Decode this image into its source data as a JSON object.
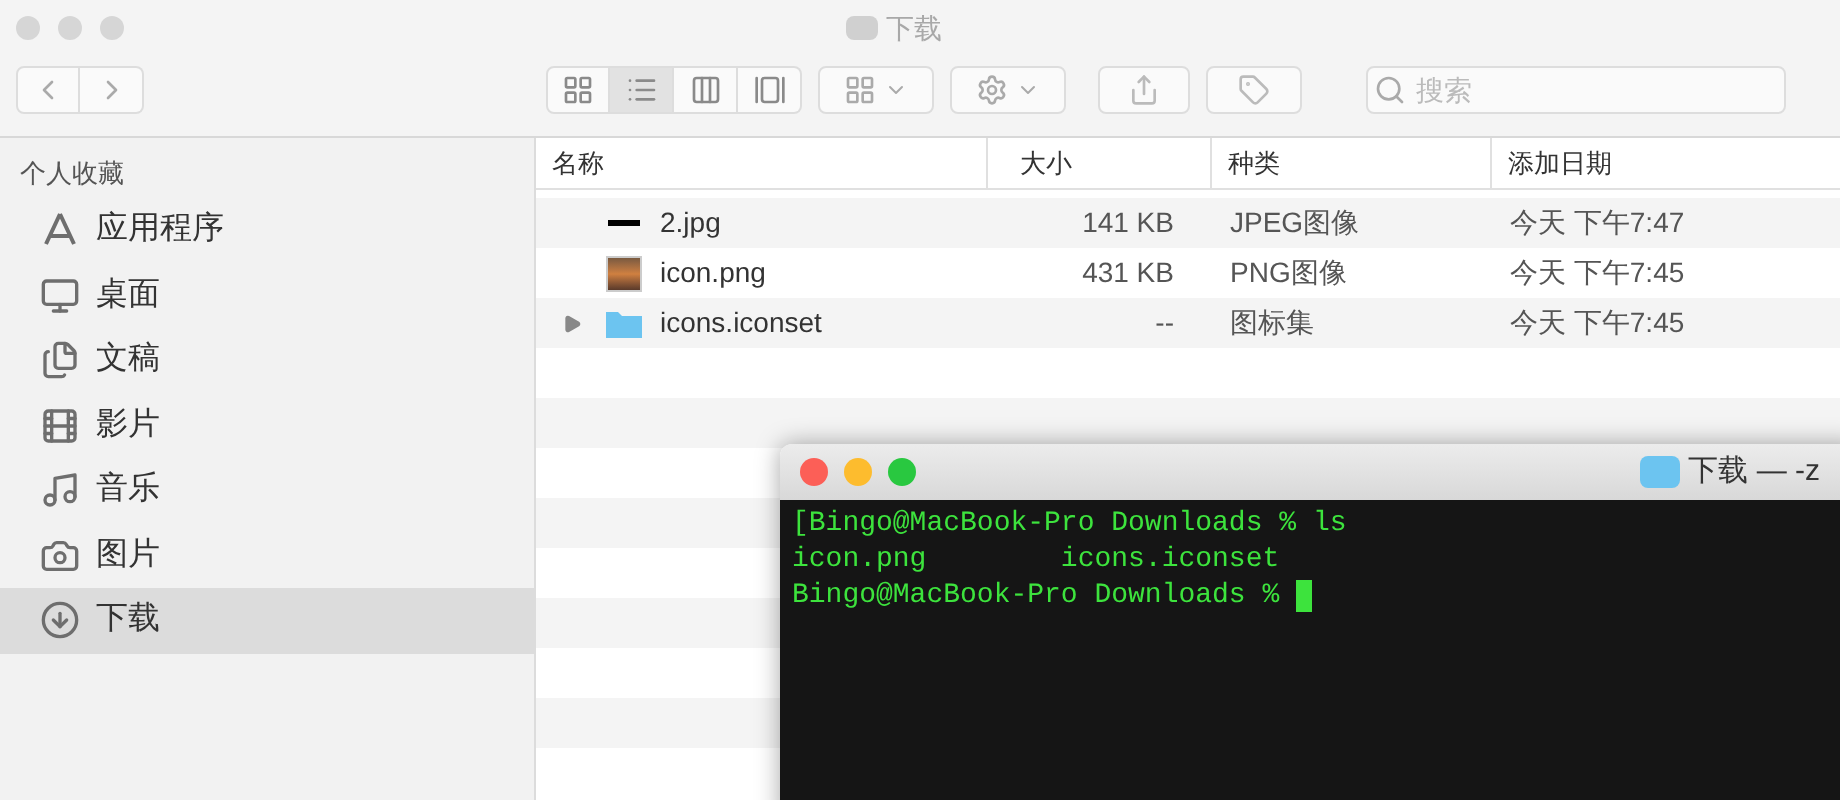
{
  "window": {
    "title": "下载"
  },
  "toolbar": {
    "view_modes": [
      {
        "kind": "icons",
        "selected": false
      },
      {
        "kind": "list",
        "selected": true
      },
      {
        "kind": "columns",
        "selected": false
      },
      {
        "kind": "gallery",
        "selected": false
      }
    ],
    "search": {
      "placeholder": "搜索"
    }
  },
  "sidebar": {
    "section": "个人收藏",
    "items": [
      {
        "label": "应用程序",
        "kind": "apps",
        "selected": false
      },
      {
        "label": "桌面",
        "kind": "desktop",
        "selected": false
      },
      {
        "label": "文稿",
        "kind": "documents",
        "selected": false
      },
      {
        "label": "影片",
        "kind": "movies",
        "selected": false
      },
      {
        "label": "音乐",
        "kind": "music",
        "selected": false
      },
      {
        "label": "图片",
        "kind": "pictures",
        "selected": false
      },
      {
        "label": "下载",
        "kind": "downloads",
        "selected": true
      }
    ]
  },
  "table": {
    "columns": [
      "名称",
      "大小",
      "种类",
      "添加日期"
    ],
    "rows": [
      {
        "kind": "jpg",
        "name": "2.jpg",
        "size": "141 KB",
        "type": "JPEG图像",
        "date": "今天 下午7:47"
      },
      {
        "kind": "png",
        "name": "icon.png",
        "size": "431 KB",
        "type": "PNG图像",
        "date": "今天 下午7:45"
      },
      {
        "kind": "folder",
        "expanded": false,
        "name": "icons.iconset",
        "size": "--",
        "type": "图标集",
        "date": "今天 下午7:45"
      }
    ]
  },
  "terminal": {
    "title": "下载 — -z",
    "lines": [
      "[Bingo@MacBook-Pro Downloads % ls",
      "icon.png        icons.iconset",
      "Bingo@MacBook-Pro Downloads % "
    ],
    "cursor": true
  }
}
